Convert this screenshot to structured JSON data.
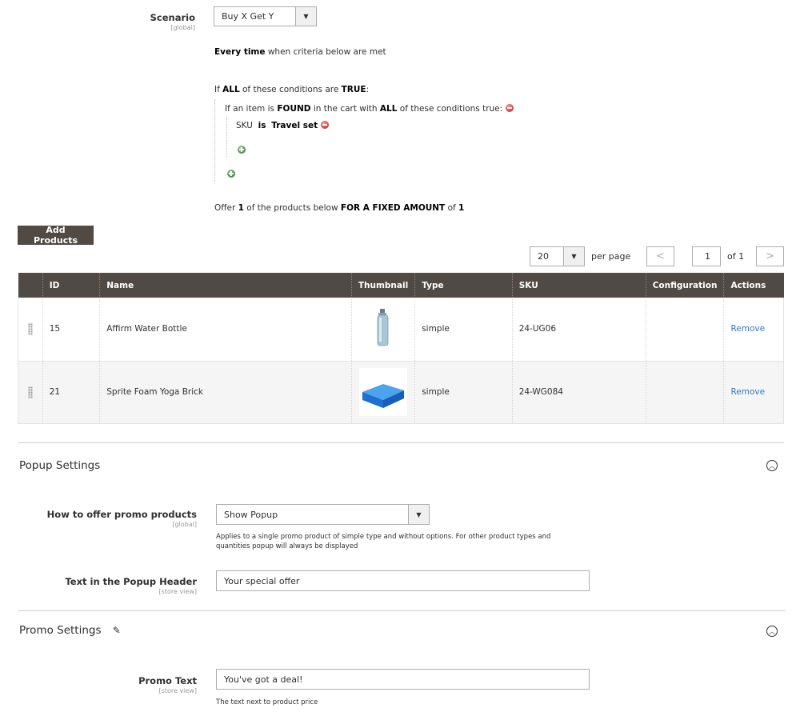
{
  "scenario": {
    "label": "Scenario",
    "scope": "[global]",
    "value": "Buy X Get Y",
    "every_time_bold": "Every time",
    "every_time_rest": "when criteria below are met"
  },
  "conditions": {
    "line1_pre": "If",
    "line1_all": "ALL",
    "line1_mid": "of these conditions are",
    "line1_true": "TRUE",
    "line1_end": ":",
    "line2_pre": "If an item is",
    "line2_found": "FOUND",
    "line2_mid": "in the cart with",
    "line2_all": "ALL",
    "line2_end": "of these conditions true:",
    "sku_attr": "SKU",
    "sku_op": "is",
    "sku_value": "Travel set"
  },
  "offer": {
    "pre": "Offer",
    "qty": "1",
    "mid": "of the products below",
    "type": "FOR A FIXED AMOUNT",
    "of": "of",
    "amount": "1"
  },
  "add_products_label": "Add Products",
  "pager": {
    "per_page_value": "20",
    "per_page_label": "per page",
    "prev": "<",
    "current_page": "1",
    "of_pages": "of 1",
    "next": ">"
  },
  "table": {
    "columns": [
      "",
      "ID",
      "Name",
      "Thumbnail",
      "Type",
      "SKU",
      "Configuration",
      "Actions"
    ],
    "rows": [
      {
        "id": "15",
        "name": "Affirm Water Bottle",
        "type": "simple",
        "sku": "24-UG06",
        "configuration": "",
        "action": "Remove",
        "thumb": "water-bottle"
      },
      {
        "id": "21",
        "name": "Sprite Foam Yoga Brick",
        "type": "simple",
        "sku": "24-WG084",
        "configuration": "",
        "action": "Remove",
        "thumb": "yoga-brick"
      }
    ]
  },
  "popup": {
    "title": "Popup Settings",
    "offer_label": "How to offer promo products",
    "offer_scope": "[global]",
    "offer_value": "Show Popup",
    "offer_note": "Applies to a single promo product of simple type and without options. For other product types and quantities popup will always be displayed",
    "header_label": "Text in the Popup Header",
    "header_scope": "[store view]",
    "header_value": "Your special offer"
  },
  "promo": {
    "title": "Promo Settings",
    "text_label": "Promo Text",
    "text_scope": "[store view]",
    "text_value": "You've got a deal!",
    "text_note": "The text next to product price"
  },
  "icons": {
    "remove_condition": "remove-condition-icon",
    "add_condition": "add-condition-icon",
    "collapse": "collapse-up-icon",
    "edit": "pencil-icon",
    "drag": "drag-handle-icon"
  },
  "colors": {
    "header_bg": "#514943",
    "link": "#2f7bc2"
  }
}
